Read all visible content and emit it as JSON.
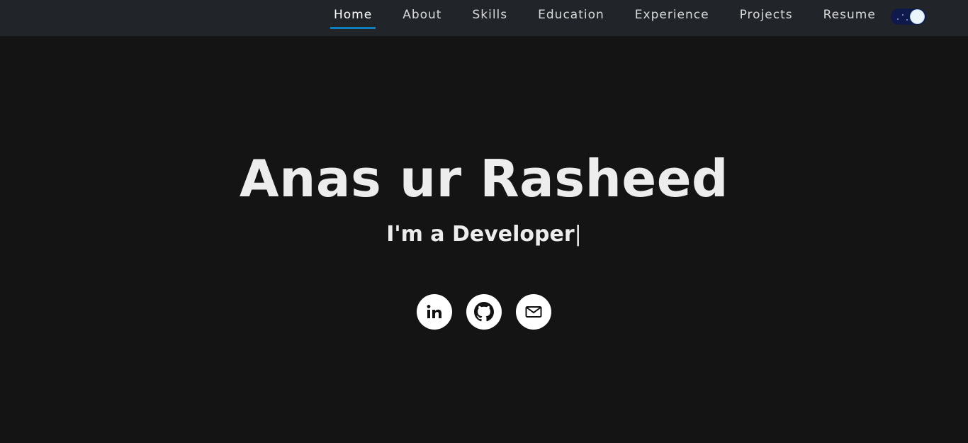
{
  "nav": {
    "items": [
      {
        "label": "Home",
        "active": true
      },
      {
        "label": "About"
      },
      {
        "label": "Skills"
      },
      {
        "label": "Education"
      },
      {
        "label": "Experience"
      },
      {
        "label": "Projects"
      },
      {
        "label": "Resume"
      }
    ],
    "theme_toggle": {
      "state": "dark",
      "icon": "moon-stars-toggle"
    }
  },
  "hero": {
    "name": "Anas ur Rasheed",
    "tagline_prefix": "I'm a ",
    "tagline_role": "Developer",
    "cursor": "|"
  },
  "socials": [
    {
      "name": "linkedin",
      "icon": "linkedin-icon",
      "glyph": "in"
    },
    {
      "name": "github",
      "icon": "github-icon"
    },
    {
      "name": "email",
      "icon": "mail-icon"
    }
  ],
  "colors": {
    "background": "#141414",
    "navbar": "#212529",
    "active_underline": "#0d7fc0",
    "text": "#ededed",
    "toggle_track": "#0f1a4a"
  }
}
